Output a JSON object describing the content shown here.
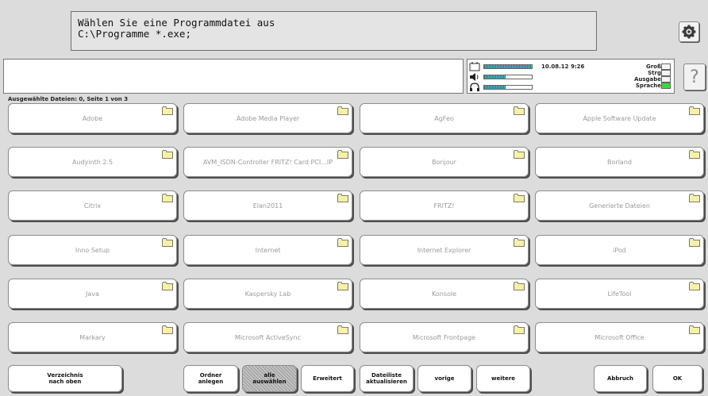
{
  "prompt": {
    "line1": "Wählen Sie eine Programmdatei aus",
    "line2": "C:\\Programme *.exe;"
  },
  "icons": {
    "settings": "gear-icon",
    "help": "question-mark-icon",
    "battery": "battery-icon",
    "speaker": "speaker-icon",
    "headphones": "headphones-icon",
    "folder": "folder-icon"
  },
  "status": {
    "datetime": "10.08.12 9:26",
    "levels": {
      "battery": 1.0,
      "speaker": 0.45,
      "headphones": 0.45
    },
    "indicators": [
      {
        "label": "Groß",
        "on": false
      },
      {
        "label": "Strg",
        "on": false
      },
      {
        "label": "Ausgabe",
        "on": false
      },
      {
        "label": "Sprache",
        "on": true
      }
    ]
  },
  "help_label": "?",
  "page_info": "Ausgewählte Dateien: 0, Seite 1 von 3",
  "folders": [
    "Adobe",
    "Adobe Media Player",
    "AgFeo",
    "Apple Software Update",
    "Audyinth 2.5",
    "AVM_ISDN-Controller FRITZ! Card PCI...IP",
    "Bonjour",
    "Borland",
    "Citrix",
    "Elan2011",
    "FRITZ!",
    "Generierte Dateien",
    "Inno Setup",
    "Internet",
    "Internet Explorer",
    "iPod",
    "Java",
    "Kaspersky Lab",
    "Konsole",
    "LifeTool",
    "Markary",
    "Microsoft ActiveSync",
    "Microsoft Frontpage",
    "Microsoft Office"
  ],
  "colors": {
    "indicator_on": "#33dd33",
    "level_fill": "#1a7e8a"
  },
  "buttons": {
    "up": "Verzeichnis\nnach oben",
    "new_folder": "Ordner\nanlegen",
    "select_all": "alle\nauswählen",
    "advanced": "Erweitert",
    "refresh": "Dateiliste\naktualisieren",
    "prev": "vorige",
    "next": "weitere",
    "cancel": "Abbruch",
    "ok": "OK"
  }
}
